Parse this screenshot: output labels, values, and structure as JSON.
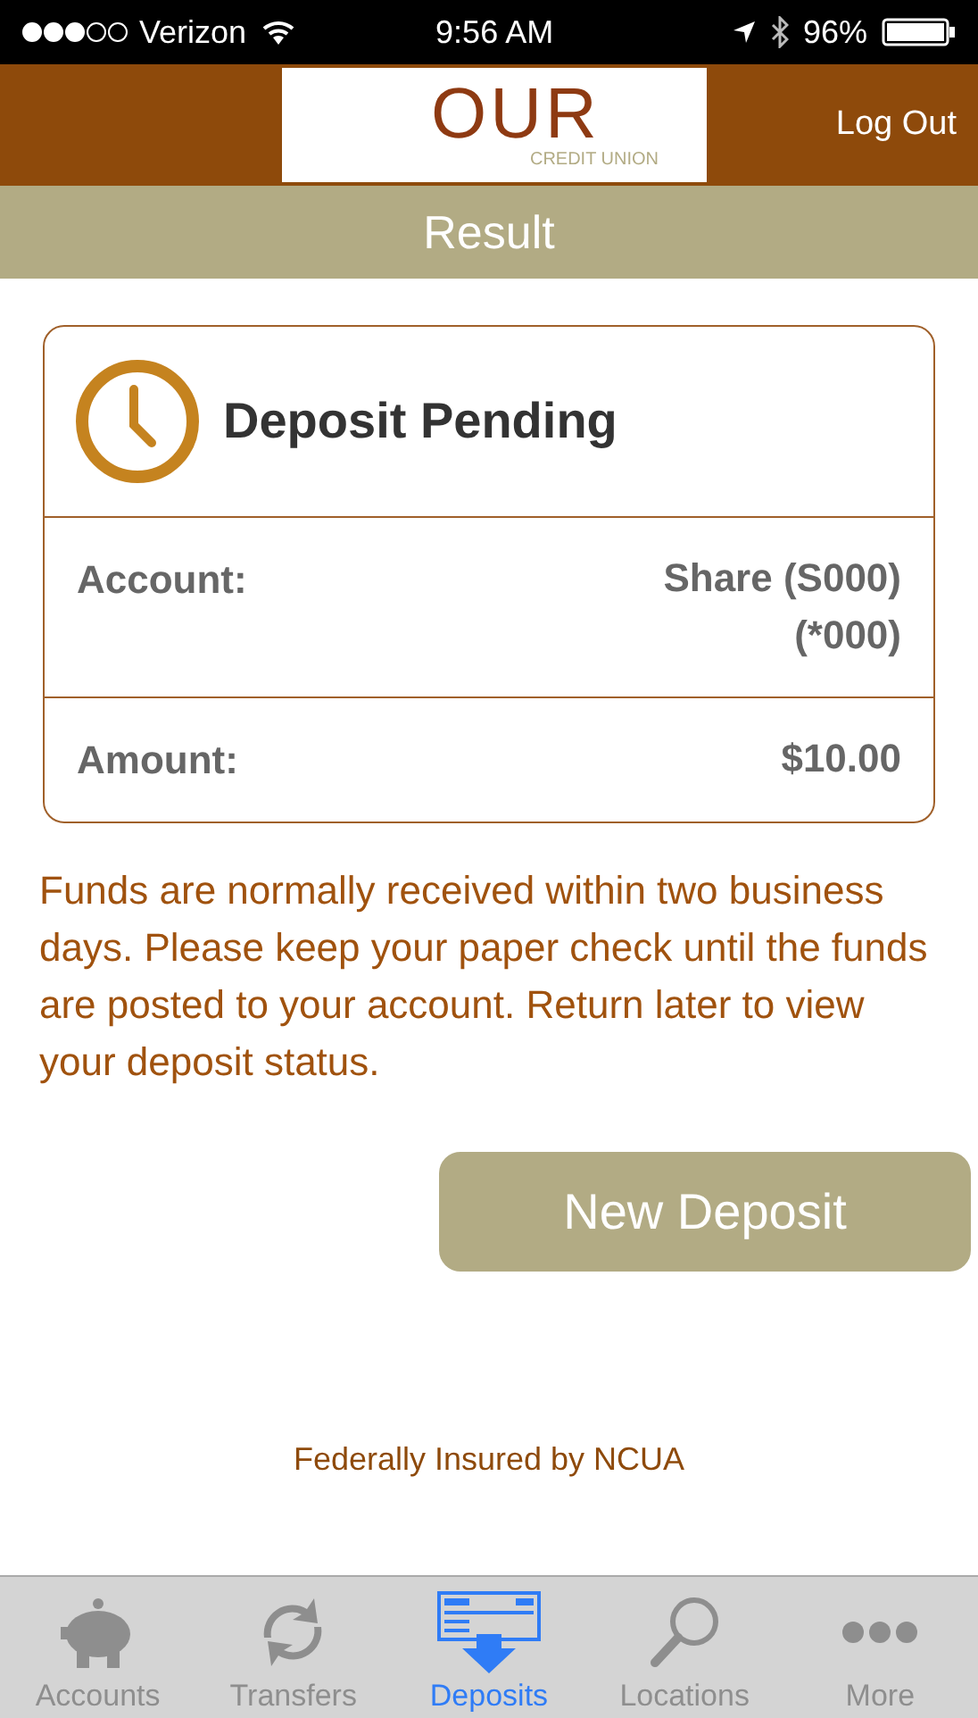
{
  "status_bar": {
    "carrier": "Verizon",
    "time": "9:56 AM",
    "battery": "96%"
  },
  "header": {
    "logo_text": "OUR",
    "logo_subtext": "CREDIT UNION",
    "logout": "Log Out"
  },
  "title": "Result",
  "card": {
    "heading": "Deposit Pending",
    "rows": [
      {
        "label": "Account:",
        "value_lines": [
          "Share (S000)",
          "(*000)"
        ]
      },
      {
        "label": "Amount:",
        "value_lines": [
          "$10.00"
        ]
      }
    ]
  },
  "notice": "Funds are normally received within two business days. Please keep your paper check until the funds are posted to your account. Return later to view your deposit status.",
  "primary_button": "New Deposit",
  "footer": "Federally Insured by NCUA",
  "tab_bar": [
    {
      "kind": "piggy",
      "label": "Accounts",
      "selected": false
    },
    {
      "kind": "transfer",
      "label": "Transfers",
      "selected": false
    },
    {
      "kind": "check",
      "label": "Deposits",
      "selected": true
    },
    {
      "kind": "search",
      "label": "Locations",
      "selected": false
    },
    {
      "kind": "more",
      "label": "More",
      "selected": false
    }
  ]
}
